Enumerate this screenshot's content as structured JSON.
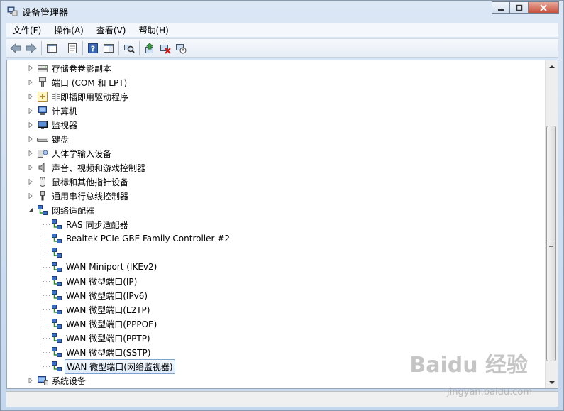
{
  "window": {
    "title": "设备管理器"
  },
  "menu": [
    "文件(F)",
    "操作(A)",
    "查看(V)",
    "帮助(H)"
  ],
  "tree": [
    {
      "label": "存储卷卷影副本",
      "icon": "storage-icon",
      "level": 0,
      "expander": "collapsed"
    },
    {
      "label": "端口 (COM 和 LPT)",
      "icon": "port-icon",
      "level": 0,
      "expander": "collapsed"
    },
    {
      "label": "非即插即用驱动程序",
      "icon": "driver-icon",
      "level": 0,
      "expander": "collapsed"
    },
    {
      "label": "计算机",
      "icon": "computer-icon",
      "level": 0,
      "expander": "collapsed"
    },
    {
      "label": "监视器",
      "icon": "monitor-icon",
      "level": 0,
      "expander": "collapsed"
    },
    {
      "label": "键盘",
      "icon": "keyboard-icon",
      "level": 0,
      "expander": "collapsed"
    },
    {
      "label": "人体学输入设备",
      "icon": "hid-icon",
      "level": 0,
      "expander": "collapsed"
    },
    {
      "label": "声音、视频和游戏控制器",
      "icon": "speaker-icon",
      "level": 0,
      "expander": "collapsed"
    },
    {
      "label": "鼠标和其他指针设备",
      "icon": "mouse-icon",
      "level": 0,
      "expander": "collapsed"
    },
    {
      "label": "通用串行总线控制器",
      "icon": "usb-icon",
      "level": 0,
      "expander": "collapsed"
    },
    {
      "label": "网络适配器",
      "icon": "network-icon",
      "level": 0,
      "expander": "expanded"
    },
    {
      "label": "RAS 同步适配器",
      "icon": "network-adapter-icon",
      "level": 1
    },
    {
      "label": "Realtek PCIe GBE Family Controller #2",
      "icon": "network-adapter-icon",
      "level": 1
    },
    {
      "label": "",
      "icon": "network-adapter-icon",
      "level": 1
    },
    {
      "label": "WAN Miniport (IKEv2)",
      "icon": "network-adapter-icon",
      "level": 1
    },
    {
      "label": "WAN 微型端口(IP)",
      "icon": "network-adapter-icon",
      "level": 1
    },
    {
      "label": "WAN 微型端口(IPv6)",
      "icon": "network-adapter-icon",
      "level": 1
    },
    {
      "label": "WAN 微型端口(L2TP)",
      "icon": "network-adapter-icon",
      "level": 1
    },
    {
      "label": "WAN 微型端口(PPPOE)",
      "icon": "network-adapter-icon",
      "level": 1
    },
    {
      "label": "WAN 微型端口(PPTP)",
      "icon": "network-adapter-icon",
      "level": 1
    },
    {
      "label": "WAN 微型端口(SSTP)",
      "icon": "network-adapter-icon",
      "level": 1
    },
    {
      "label": "WAN 微型端口(网络监视器)",
      "icon": "network-adapter-icon",
      "level": 1,
      "selected": true
    },
    {
      "label": "系统设备",
      "icon": "system-device-icon",
      "level": 0,
      "expander": "collapsed"
    }
  ],
  "watermark": {
    "brand": "Baidu 经验",
    "url": "jingyan.baidu.com"
  }
}
